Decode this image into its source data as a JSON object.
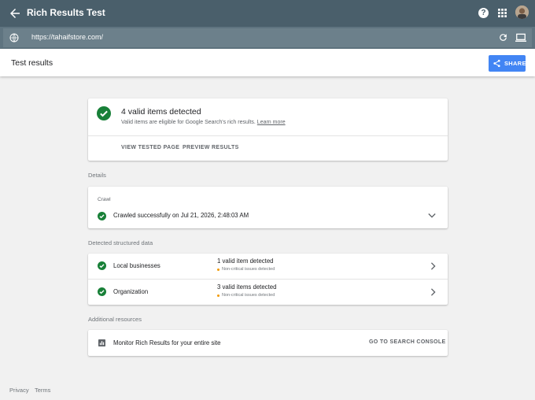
{
  "app": {
    "title": "Rich Results Test",
    "help_icon": "help-icon",
    "apps_icon": "apps-grid-icon",
    "avatar_icon": "account-avatar"
  },
  "url_bar": {
    "url": "https://tahaifstore.com/",
    "left_icon": "globe-icon",
    "reload_icon": "reload-icon",
    "device_icon": "desktop-device-icon"
  },
  "results": {
    "title": "Test results",
    "share_label": "SHARE",
    "share_icon": "share-icon"
  },
  "summary": {
    "title": "4 valid items detected",
    "subtitle": "Valid items are eligible for Google Search's rich results.",
    "learn_more": "Learn more",
    "view_tested_page": "VIEW TESTED PAGE",
    "preview_results": "PREVIEW RESULTS"
  },
  "details": {
    "section_label": "Details",
    "crawl_label": "Crawl",
    "crawl_status": "Crawled successfully on Jul 21, 2026, 2:48:03 AM"
  },
  "structured_data": {
    "section_label": "Detected structured data",
    "items": [
      {
        "name": "Local businesses",
        "count": "1 valid item detected",
        "note": "Non-critical issues detected"
      },
      {
        "name": "Organization",
        "count": "3 valid items detected",
        "note": "Non-critical issues detected"
      }
    ]
  },
  "resources": {
    "section_label": "Additional resources",
    "monitor_text": "Monitor Rich Results for your entire site",
    "console_link": "GO TO SEARCH CONSOLE"
  },
  "footer": {
    "privacy": "Privacy",
    "terms": "Terms"
  },
  "colors": {
    "header": "#4a5f6b",
    "url_bar": "#5f7480",
    "accent_blue": "#4285f4",
    "success_green": "#188038",
    "warning_orange": "#f29900"
  }
}
